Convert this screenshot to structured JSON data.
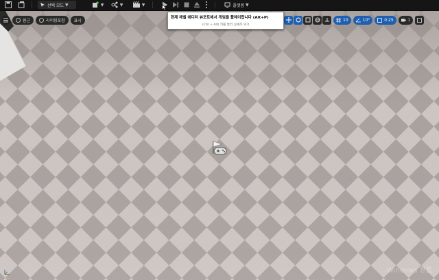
{
  "toolbar": {
    "mode_label": "선택 모드",
    "platforms_label": "플랫폼",
    "items": [
      {
        "name": "save-icon"
      },
      {
        "name": "content-browser-icon"
      },
      {
        "name": "add-actor-icon"
      },
      {
        "name": "blueprint-icon"
      },
      {
        "name": "cinematics-icon"
      },
      {
        "name": "play-icon"
      },
      {
        "name": "advance-frame-icon"
      },
      {
        "name": "stop-icon"
      },
      {
        "name": "eject-icon"
      },
      {
        "name": "more-options-icon"
      }
    ]
  },
  "viewport_toolbar": {
    "menu_icon": "hamburger-icon",
    "perspective_label": "원근",
    "lighting_label": "라이팅포함",
    "show_label": "표시",
    "grid_snap_value": "10",
    "rotation_snap_value": "10°",
    "scale_snap_value": "0.25",
    "camera_speed_value": "1"
  },
  "tooltip": {
    "title": "현재 레벨 에디터 뷰포트에서 게임을 플레이합니다 (Alt+P)",
    "subtitle": "(Ctrl + Alt) 키를 눌러 상세히 보기"
  },
  "watermark": "Windows 정품",
  "colors": {
    "tile_light": "#cdc5c1",
    "tile_dark": "#a9a19e",
    "accent_blue": "#1f5fb0"
  }
}
